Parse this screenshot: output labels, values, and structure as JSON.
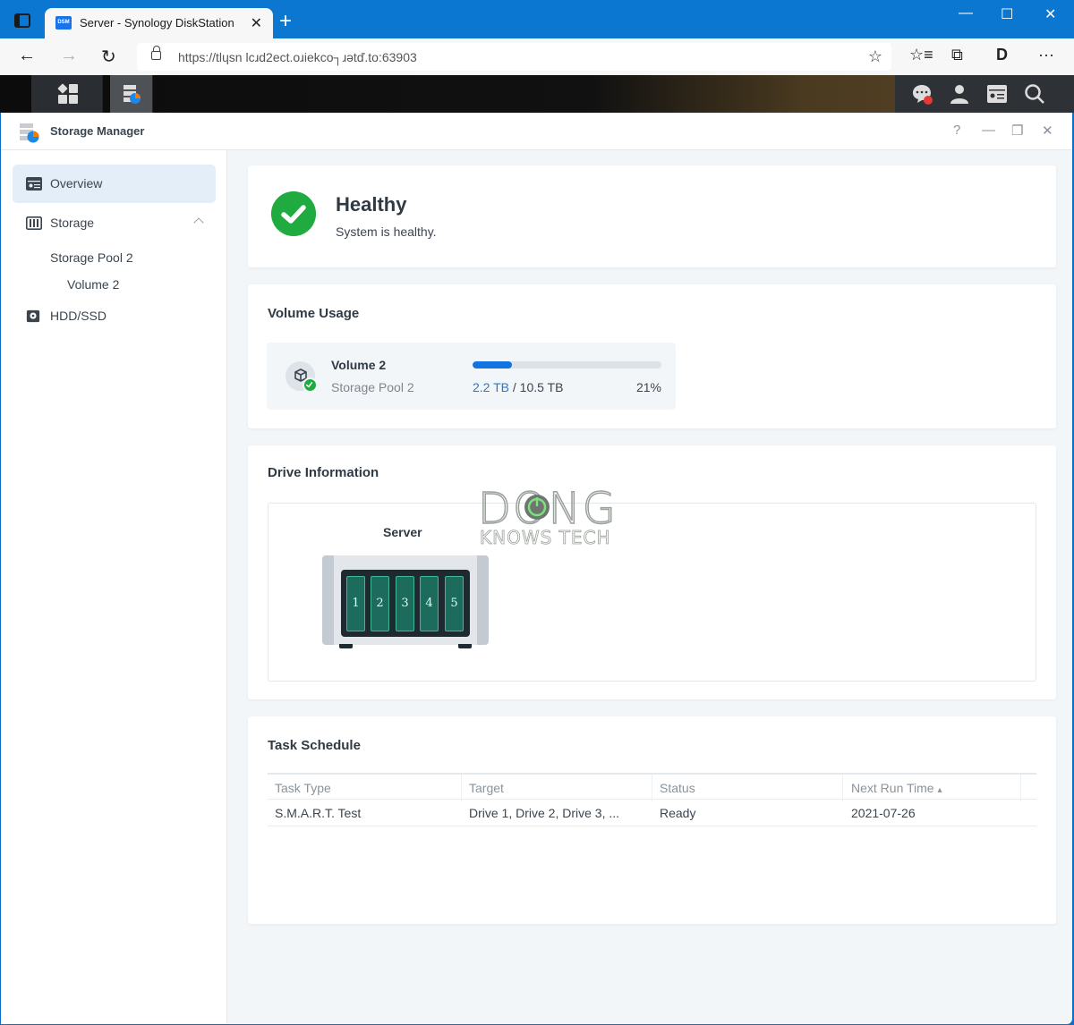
{
  "browser": {
    "tab_title": "Server - Synology DiskStation",
    "tab_favicon_text": "DSM",
    "tab_close": "✕",
    "new_tab": "+",
    "url": "https://tlɥsn lcɹd2ect.oɹiekco┐ɹətď.to:63903",
    "window_controls": {
      "minimize": "—",
      "maximize": "☐",
      "close": "✕"
    },
    "nav": {
      "back": "←",
      "forward": "→",
      "refresh": "↻"
    },
    "toolbar": {
      "add_favorite": "☆",
      "favorites": "☆≡",
      "collections": "⧉",
      "extension": "D",
      "more": "···"
    }
  },
  "dsm": {
    "notification_badge_color": "#e53935"
  },
  "app": {
    "title": "Storage Manager",
    "header_controls": {
      "help": "?",
      "minimize": "—",
      "restore": "❐",
      "close": "✕"
    },
    "sidebar": {
      "items": [
        {
          "label": "Overview",
          "active": true
        },
        {
          "label": "Storage",
          "expanded": true
        },
        {
          "label": "HDD/SSD"
        }
      ],
      "sub_items": [
        {
          "label": "Storage Pool 2"
        },
        {
          "label": "Volume 2"
        }
      ]
    },
    "health": {
      "title": "Healthy",
      "subtitle": "System is healthy.",
      "color": "#1fab3f"
    },
    "volume_usage": {
      "title": "Volume Usage",
      "volume_name": "Volume 2",
      "pool_name": "Storage Pool 2",
      "used": "2.2 TB",
      "separator_total": " / 10.5 TB",
      "percent_label": "21%",
      "percent": 21,
      "bar_color": "#1274e0"
    },
    "drive_info": {
      "title": "Drive Information",
      "server_name": "Server",
      "bays": [
        "1",
        "2",
        "3",
        "4",
        "5"
      ],
      "watermark_top": "DONG",
      "watermark_bottom": "KNOWS TECH"
    },
    "task_schedule": {
      "title": "Task Schedule",
      "columns": [
        "Task Type",
        "Target",
        "Status",
        "Next Run Time"
      ],
      "sort_indicator": "▴",
      "rows": [
        [
          "S.M.A.R.T. Test",
          "Drive 1, Drive 2, Drive 3, ...",
          "Ready",
          "2021-07-26"
        ]
      ]
    }
  }
}
